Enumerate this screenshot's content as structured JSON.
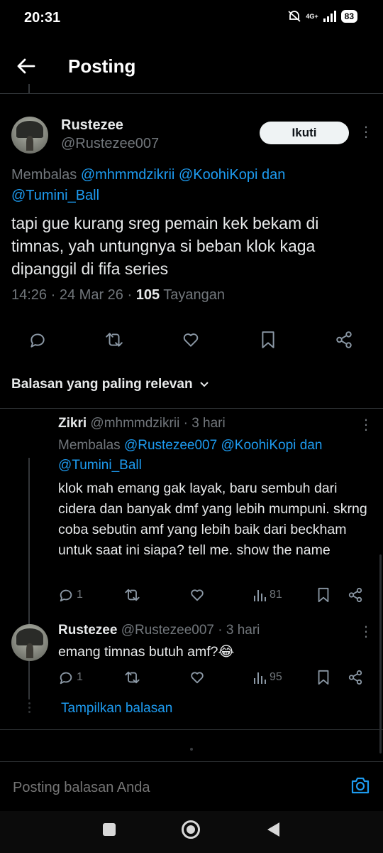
{
  "status_bar": {
    "time": "20:31",
    "network": "4G+",
    "battery": "83"
  },
  "header": {
    "title": "Posting"
  },
  "main_post": {
    "author_name": "Rustezee",
    "author_handle": "@Rustezee007",
    "follow_label": "Ikuti",
    "reply_prefix": "Membalas",
    "reply_user_1": "@mhmmdzikrii",
    "reply_user_2": "@KoohiKopi",
    "reply_and": "dan",
    "reply_user_3": "@Tumini_Ball",
    "text": "tapi gue kurang sreg pemain kek bekam di timnas, yah untungnya si beban klok kaga dipanggil di fifa series",
    "time": "14:26",
    "sep": "·",
    "date": "24 Mar 26",
    "views": "105",
    "views_label": "Tayangan"
  },
  "sort": {
    "label": "Balasan yang paling relevan"
  },
  "replies": [
    {
      "name": "Zikri",
      "handle": "@mhmmdzikrii",
      "age": "· 3 hari",
      "reply_prefix": "Membalas",
      "reply_user_1": "@Rustezee007",
      "reply_user_2": "@KoohiKopi",
      "reply_and": "dan",
      "reply_user_3": "@Tumini_Ball",
      "text": "klok mah emang gak layak, baru sembuh dari cidera dan banyak dmf yang lebih mumpuni. skrng coba sebutin amf yang lebih baik dari beckham untuk saat ini siapa? tell me. show the name",
      "replies_count": "1",
      "views": "81"
    },
    {
      "name": "Rustezee",
      "handle": "@Rustezee007",
      "age": "· 3 hari",
      "text": "emang timnas butuh amf?😂",
      "replies_count": "1",
      "views": "95"
    }
  ],
  "show_replies": "Tampilkan balasan",
  "compose": {
    "placeholder": "Posting balasan Anda"
  },
  "colors": {
    "accent": "#1d9bf0",
    "background": "#000000",
    "muted": "#71767b"
  }
}
